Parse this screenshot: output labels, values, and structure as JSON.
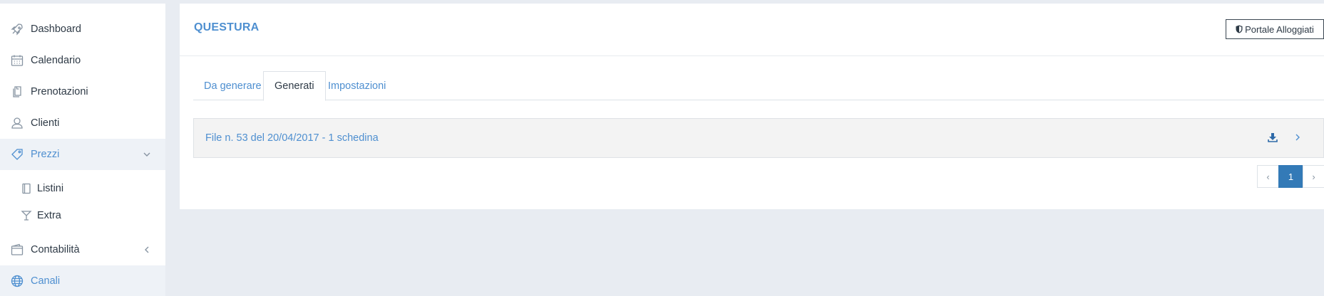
{
  "sidebar": {
    "items": [
      {
        "label": "Dashboard",
        "icon": "rocket-icon"
      },
      {
        "label": "Calendario",
        "icon": "calendar-icon"
      },
      {
        "label": "Prenotazioni",
        "icon": "documents-icon"
      },
      {
        "label": "Clienti",
        "icon": "user-icon"
      },
      {
        "label": "Prezzi",
        "icon": "tag-icon",
        "expanded": true
      },
      {
        "label": "Contabilità",
        "icon": "wallet-icon",
        "expanded": false
      },
      {
        "label": "Canali",
        "icon": "globe-icon"
      }
    ],
    "subitems": [
      {
        "label": "Listini",
        "icon": "notebook-icon"
      },
      {
        "label": "Extra",
        "icon": "cocktail-icon"
      }
    ]
  },
  "header": {
    "title": "QUESTURA",
    "portal_button": "Portale Alloggiati"
  },
  "tabs": [
    {
      "label": "Da generare",
      "active": false
    },
    {
      "label": "Generati",
      "active": true
    },
    {
      "label": "Impostazioni",
      "active": false
    }
  ],
  "files": [
    {
      "label": "File n. 53 del 20/04/2017 - 1 schedina"
    }
  ],
  "pagination": {
    "prev": "‹",
    "current": "1",
    "next": "›"
  },
  "colors": {
    "accent": "#4e8fd0",
    "page_active": "#337ab7",
    "background": "#e8ecf2"
  }
}
